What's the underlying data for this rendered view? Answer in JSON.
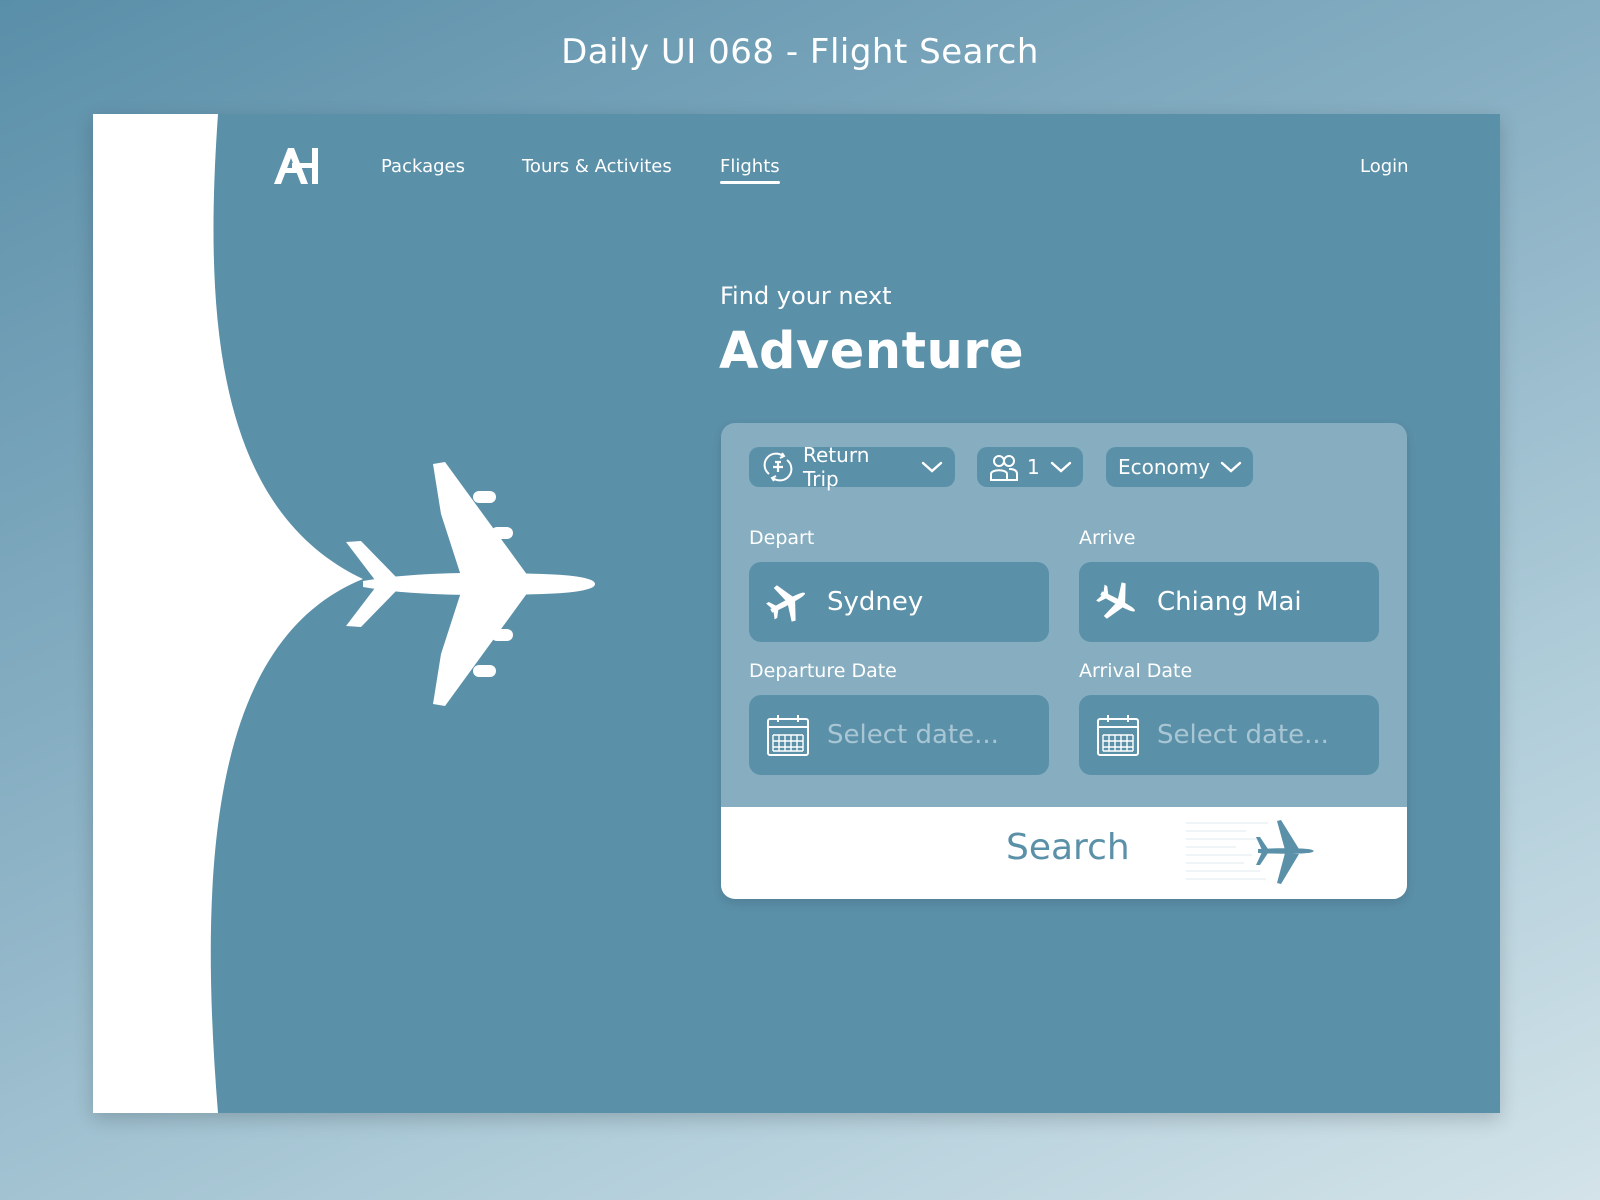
{
  "shot_title": "Daily UI 068 - Flight Search",
  "brand": {
    "logo_text": "AH"
  },
  "nav": {
    "items": [
      {
        "label": "Packages",
        "active": false
      },
      {
        "label": "Tours & Activites",
        "active": false
      },
      {
        "label": "Flights",
        "active": true
      }
    ],
    "login": "Login"
  },
  "hero": {
    "subtitle": "Find your next",
    "title": "Adventure"
  },
  "search": {
    "trip_type": "Return Trip",
    "passengers": "1",
    "cabin_class": "Economy",
    "depart": {
      "label": "Depart",
      "value": "Sydney"
    },
    "arrive": {
      "label": "Arrive",
      "value": "Chiang Mai"
    },
    "departure_date": {
      "label": "Departure Date",
      "placeholder": "Select date..."
    },
    "arrival_date": {
      "label": "Arrival Date",
      "placeholder": "Select date..."
    },
    "button_label": "Search"
  },
  "icons": {
    "trip_type": "round-trip-icon",
    "passengers": "users-icon",
    "depart": "plane-takeoff-icon",
    "arrive": "plane-landing-icon",
    "date": "calendar-icon",
    "dropdown": "chevron-down-icon",
    "search": "plane-icon"
  },
  "colors": {
    "background_start": "#5a8fa9",
    "background_end": "#d3e3e9",
    "primary": "#5b90a9",
    "panel": "#86aec0",
    "surface": "#ffffff",
    "placeholder": "#a9c6d4"
  }
}
